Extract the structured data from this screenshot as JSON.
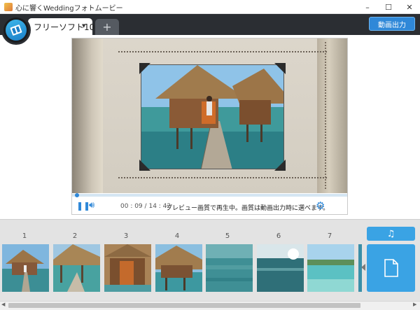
{
  "window": {
    "title": "心に響くWeddingフォトムービー",
    "controls": {
      "minimize": "–",
      "maximize": "☐",
      "close": "✕"
    }
  },
  "tabs": {
    "active_label": "フリーソフト10",
    "add_label": "+"
  },
  "toolbar": {
    "export_label": "動画出力"
  },
  "player": {
    "current_time": "00 : 09",
    "separator": "/",
    "total_time": "14 : 42",
    "status_message": "プレビュー画質で再生中。画質は動画出力時に選べます。",
    "progress": 0.01
  },
  "timeline": {
    "slots": [
      {
        "number": "1",
        "scene": "bungalow-walkway"
      },
      {
        "number": "2",
        "scene": "thatched-pier"
      },
      {
        "number": "3",
        "scene": "hut-door"
      },
      {
        "number": "4",
        "scene": "overwater-hut"
      },
      {
        "number": "5",
        "scene": "sea-surface"
      },
      {
        "number": "6",
        "scene": "ocean-sun"
      },
      {
        "number": "7",
        "scene": "beach-lagoon"
      }
    ],
    "music_icon": "♫"
  },
  "colors": {
    "accent": "#2f88d8",
    "tab_bar": "#2b2e33",
    "tile_blue": "#3aa3e4"
  }
}
